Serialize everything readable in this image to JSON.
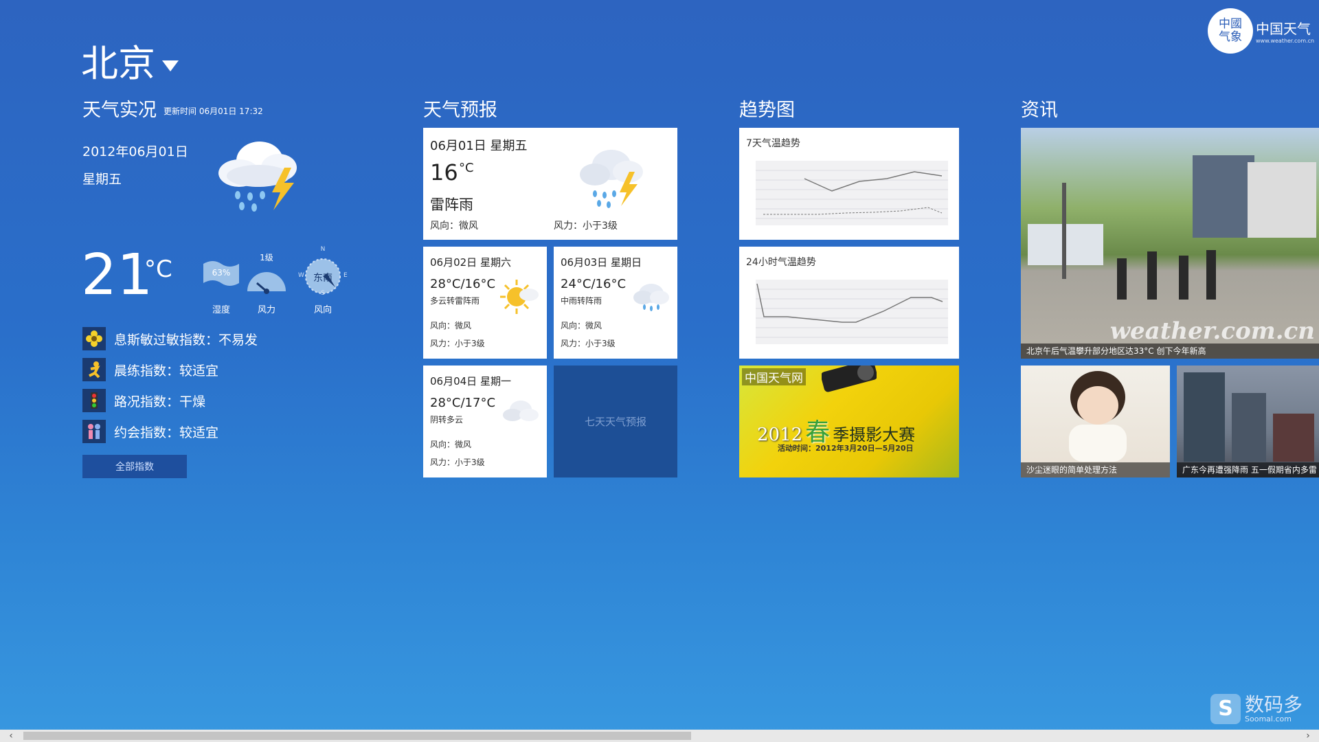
{
  "header": {
    "city": "北京"
  },
  "logo": {
    "seal_text": "中國气象",
    "name": "中国天气",
    "url": "www.weather.com.cn"
  },
  "current": {
    "title": "天气实况",
    "update_label": "更新时间 06月01日 17:32",
    "date": "2012年06月01日",
    "weekday": "星期五",
    "temp": "21",
    "temp_unit": "°C",
    "humidity_value": "63%",
    "humidity_label": "湿度",
    "wind_value": "1级",
    "wind_label": "风力",
    "dir_value": "东南",
    "dir_label": "风向",
    "compass": {
      "n": "N",
      "s": "S",
      "w": "W",
      "e": "E"
    },
    "indexes": [
      {
        "icon": "flower-icon",
        "text": "息斯敏过敏指数：不易发"
      },
      {
        "icon": "runner-icon",
        "text": "晨练指数：较适宜"
      },
      {
        "icon": "traffic-light-icon",
        "text": "路况指数：干燥"
      },
      {
        "icon": "couple-icon",
        "text": "约会指数：较适宜"
      }
    ],
    "all_button": "全部指数"
  },
  "forecast": {
    "title": "天气预报",
    "today": {
      "date": "06月01日 星期五",
      "temp": "16",
      "unit": "°C",
      "desc": "雷阵雨",
      "wind_dir": "风向：微风",
      "wind_speed": "风力：小于3级"
    },
    "days": [
      {
        "date": "06月02日 星期六",
        "temp": "28°C/16°C",
        "desc": "多云转雷阵雨",
        "wind_dir": "风向：微风",
        "wind_speed": "风力：小于3级"
      },
      {
        "date": "06月03日 星期日",
        "temp": "24°C/16°C",
        "desc": "中雨转阵雨",
        "wind_dir": "风向：微风",
        "wind_speed": "风力：小于3级"
      },
      {
        "date": "06月04日 星期一",
        "temp": "28°C/17°C",
        "desc": "阴转多云",
        "wind_dir": "风向：微风",
        "wind_speed": "风力：小于3级"
      }
    ],
    "seven_day": "七天天气预报"
  },
  "trend": {
    "title": "趋势图",
    "chart7_title": "7天气温趋势",
    "chart24_title": "24小时气温趋势",
    "banner_site": "中国天气网",
    "banner_year": "2012",
    "banner_spring": "春",
    "banner_title": "季摄影大赛",
    "banner_sub": "活动时间：2012年3月20日—5月20日"
  },
  "news": {
    "title": "资讯",
    "items": [
      {
        "caption": "北京午后气温攀升部分地区达33°C 创下今年新高"
      },
      {
        "caption": "沙尘迷眼的简单处理方法"
      },
      {
        "caption": "广东今再遭强降雨 五一假期省内多雷"
      }
    ],
    "watermark": "weather.com.cn"
  },
  "site_watermark": {
    "letter": "S",
    "name": "数码多",
    "url": "Soomal.com"
  },
  "colors": {
    "accent": "#2d64c0",
    "tile_dark": "#1d4f96",
    "sun": "#f6c12a"
  }
}
